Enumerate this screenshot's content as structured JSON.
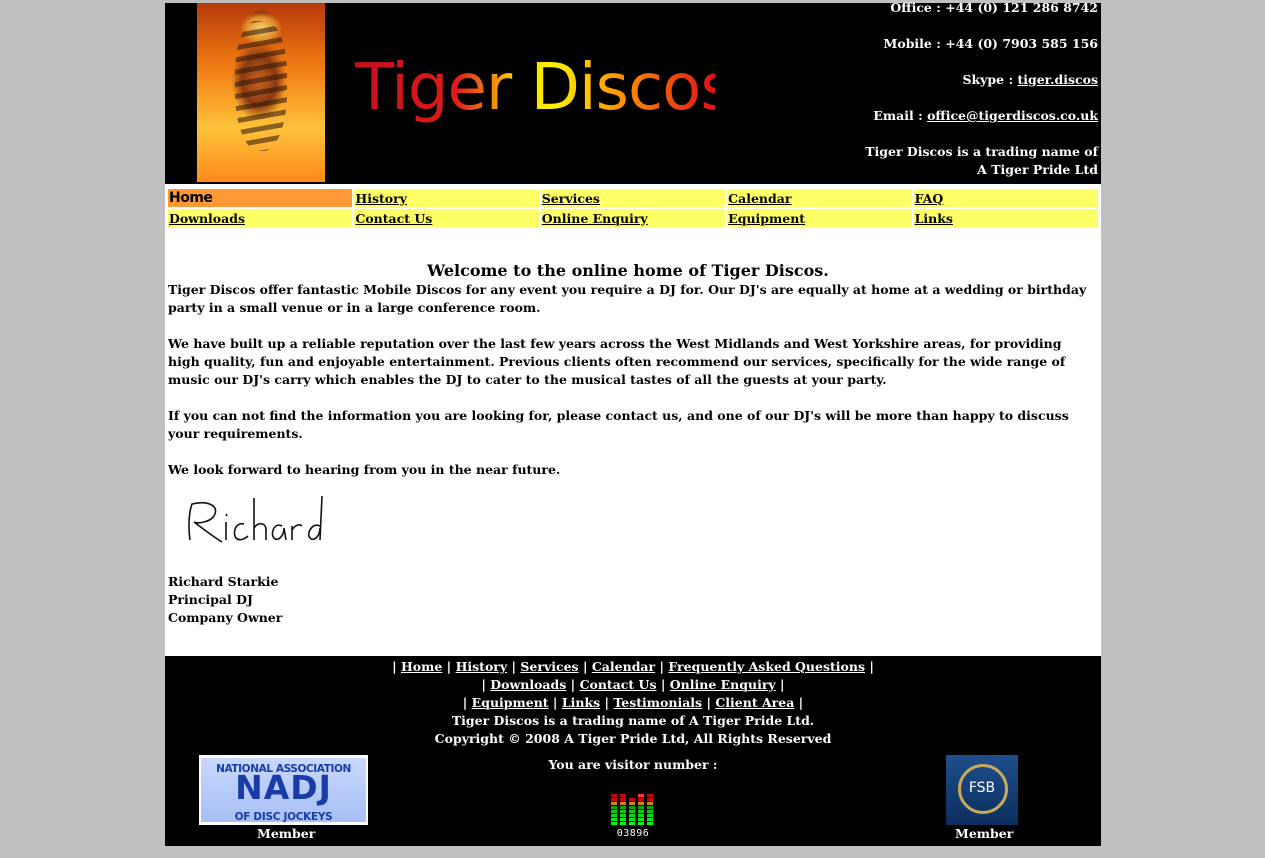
{
  "header": {
    "logo": "Tiger Discos",
    "office_label": "Office :",
    "office_value": "+44 (0) 121 286 8742",
    "mobile_label": "Mobile :",
    "mobile_value": "+44 (0) 7903 585 156",
    "skype_label": "Skype :",
    "skype_value": "tiger.discos",
    "email_label": "Email :",
    "email_value": "office@tigerdiscos.co.uk",
    "trading_line1": "Tiger Discos is a trading name of",
    "trading_line2": "A Tiger Pride Ltd"
  },
  "nav": {
    "row1": [
      "Home",
      "History",
      "Services",
      "Calendar",
      "FAQ"
    ],
    "row2": [
      "Downloads",
      "Contact Us",
      "Online Enquiry",
      "Equipment",
      "Links"
    ],
    "active": "Home",
    "active_color": "#ff9933",
    "item_color": "#ffff66"
  },
  "content": {
    "welcome": "Welcome to the online home of Tiger Discos.",
    "para1": "Tiger Discos offer fantastic Mobile Discos for any event you require a DJ for. Our DJ's are equally at home at a wedding or birthday party in a small venue or in a large conference room.",
    "para2": "We have built up a reliable reputation over the last few years across the West Midlands and West Yorkshire areas, for providing high quality, fun and enjoyable entertainment. Previous clients often recommend our services, specifically for the wide range of music our DJ's carry which enables the DJ to cater to the musical tastes of all the guests at your party.",
    "para3": "If you can not find the information you are looking for, please contact us, and one of our DJ's will be more than happy to discuss your requirements.",
    "para4": "We look forward to hearing from you in the near future.",
    "signature": "Richard",
    "sig_name": "Richard Starkie",
    "sig_title1": "Principal DJ",
    "sig_title2": "Company Owner"
  },
  "footer": {
    "links_row1": [
      "Home",
      "History",
      "Services",
      "Calendar",
      "Frequently Asked Questions"
    ],
    "links_row2": [
      "Downloads",
      "Contact Us",
      "Online Enquiry"
    ],
    "links_row3": [
      "Equipment",
      "Links",
      "Testimonials",
      "Client Area"
    ],
    "trading": "Tiger Discos is a trading name of A Tiger Pride Ltd.",
    "copyright": "Copyright © 2008 A Tiger Pride Ltd, All Rights Reserved",
    "visitor_label": "You are visitor number :",
    "visitor_count": "03896",
    "nadj_line1": "NATIONAL ASSOCIATION",
    "nadj_line2": "NADJ",
    "nadj_line3": "OF DISC JOCKEYS",
    "nadj_member": "Member",
    "fsb_text": "FSB",
    "fsb_member": "Member"
  }
}
